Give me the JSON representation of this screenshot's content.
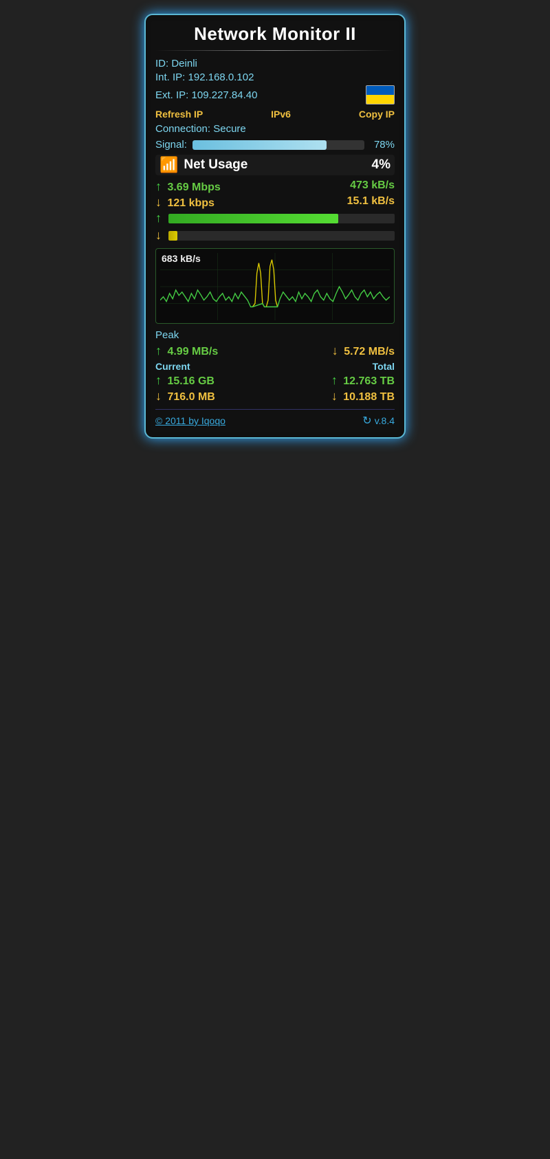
{
  "widget": {
    "title": "Network Monitor II",
    "id_label": "ID:",
    "id_value": "Deinli",
    "int_ip_label": "Int. IP:",
    "int_ip_value": "192.168.0.102",
    "ext_ip_label": "Ext. IP:",
    "ext_ip_value": "109.227.84.40",
    "refresh_btn": "Refresh IP",
    "ipv6_btn": "IPv6",
    "copy_ip_btn": "Copy IP",
    "connection_label": "Connection:",
    "connection_value": "Secure",
    "signal_label": "Signal:",
    "signal_pct": "78%",
    "signal_fill_width": "78%",
    "net_usage_label": "Net Usage",
    "net_usage_pct": "4%",
    "upload_speed": "3.69 Mbps",
    "upload_speed_kb": "473 kB/s",
    "download_speed": "121 kbps",
    "download_speed_kb": "15.1 kB/s",
    "upload_bar_width": "75%",
    "download_bar_width": "4%",
    "graph_label": "683 kB/s",
    "peak_title": "Peak",
    "peak_up": "4.99 MB/s",
    "peak_down": "5.72 MB/s",
    "current_title": "Current",
    "total_title": "Total",
    "current_up": "15.16 GB",
    "current_down": "716.0 MB",
    "total_up": "12.763 TB",
    "total_down": "10.188 TB",
    "footer_link": "© 2011 by Iqoqo",
    "version": "v.8.4"
  }
}
